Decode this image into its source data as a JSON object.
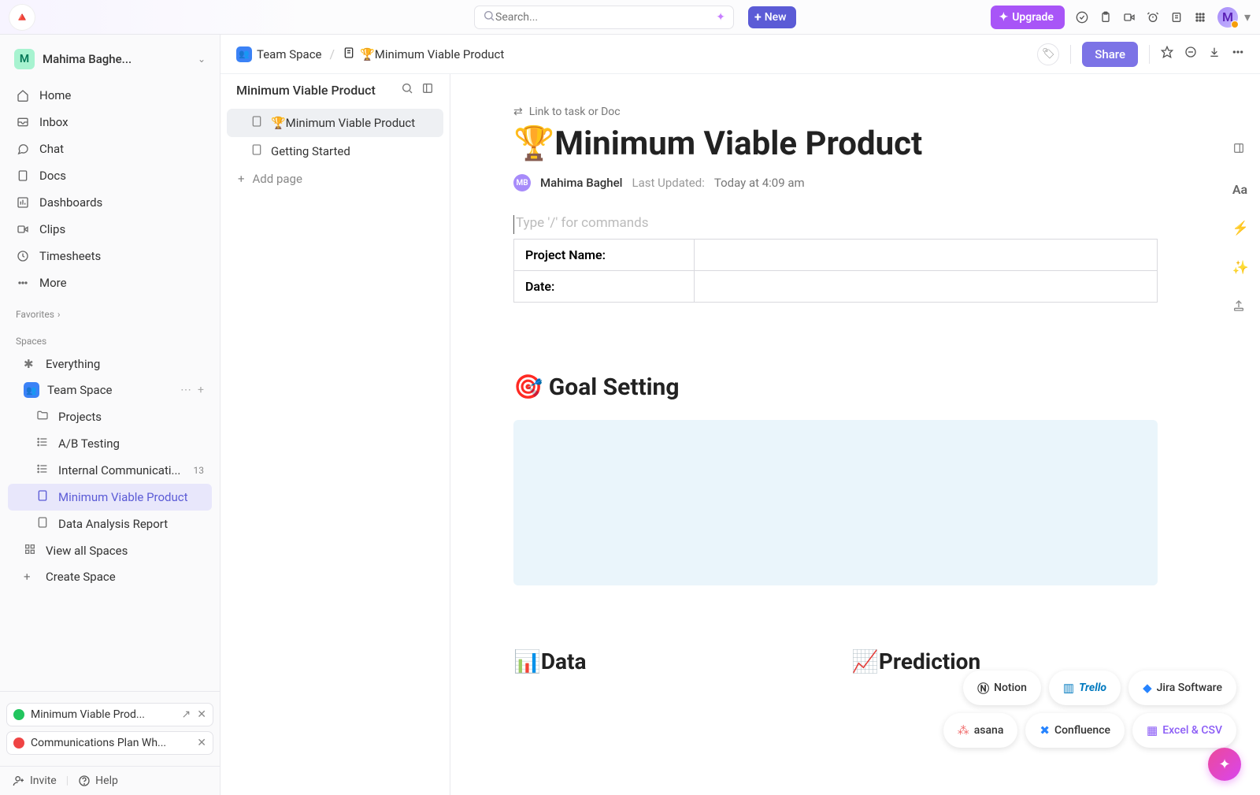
{
  "topbar": {
    "search_placeholder": "Search...",
    "new_label": "New",
    "upgrade_label": "Upgrade",
    "avatar_initial": "M"
  },
  "workspace": {
    "initial": "M",
    "name": "Mahima Baghe..."
  },
  "nav": [
    {
      "icon": "home",
      "label": "Home"
    },
    {
      "icon": "inbox",
      "label": "Inbox"
    },
    {
      "icon": "chat",
      "label": "Chat"
    },
    {
      "icon": "doc",
      "label": "Docs"
    },
    {
      "icon": "dash",
      "label": "Dashboards"
    },
    {
      "icon": "clip",
      "label": "Clips"
    },
    {
      "icon": "time",
      "label": "Timesheets"
    },
    {
      "icon": "more",
      "label": "More"
    }
  ],
  "sections": {
    "favorites": "Favorites",
    "spaces": "Spaces"
  },
  "tree": {
    "everything": "Everything",
    "teamspace": "Team Space",
    "projects": "Projects",
    "ab": "A/B Testing",
    "comm": "Internal Communicati...",
    "comm_badge": "13",
    "mvp": "Minimum Viable Product",
    "dar": "Data Analysis Report",
    "viewall": "View all Spaces",
    "create": "Create Space"
  },
  "bottom_chips": [
    {
      "status": "ok",
      "label": "Minimum Viable Prod...",
      "ext": true
    },
    {
      "status": "err",
      "label": "Communications Plan Wh...",
      "ext": false
    }
  ],
  "footer": {
    "invite": "Invite",
    "help": "Help"
  },
  "breadcrumb": {
    "space": "Team Space",
    "doc": "🏆Minimum Viable Product",
    "share": "Share"
  },
  "docs_sidebar": {
    "title": "Minimum Viable Product",
    "items": [
      "🏆Minimum Viable Product",
      "Getting Started"
    ],
    "add": "Add page"
  },
  "doc": {
    "link_task": "Link to task or Doc",
    "title": "🏆Minimum Viable Product",
    "author_initials": "MB",
    "author": "Mahima Baghel",
    "updated_label": "Last Updated:",
    "updated_value": "Today at 4:09 am",
    "command_placeholder": "Type '/' for commands",
    "table": {
      "row1_label": "Project Name:",
      "row1_value": "",
      "row2_label": "Date:",
      "row2_value": ""
    },
    "goal_heading": "🎯 Goal Setting",
    "data_heading": "📊Data",
    "pred_heading": "📈Prediction"
  },
  "imports": [
    "Notion",
    "Trello",
    "Jira Software",
    "asana",
    "Confluence",
    "Excel & CSV"
  ]
}
